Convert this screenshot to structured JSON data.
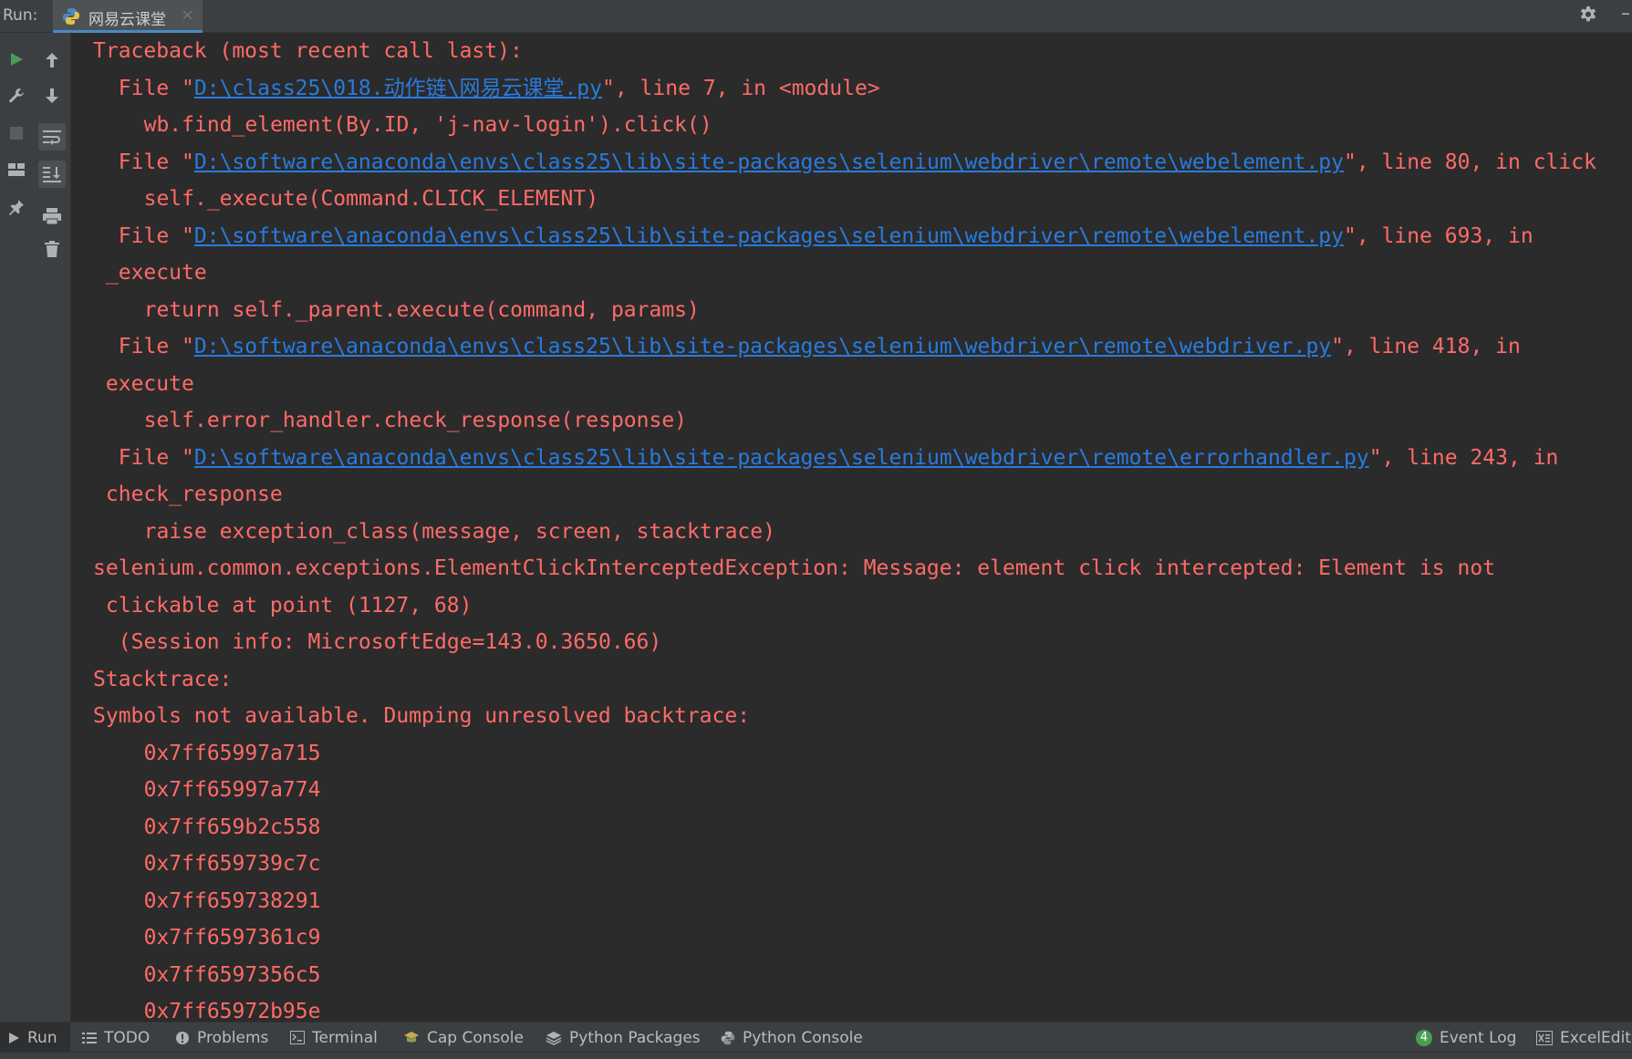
{
  "header": {
    "run_label": "Run:",
    "tab_title": "网易云课堂",
    "tab_close": "×",
    "hide_glyph": "–"
  },
  "console": {
    "lines": [
      {
        "indent": 0,
        "text": "Traceback (most recent call last):"
      },
      {
        "indent": 2,
        "pre": "File \"",
        "link": "D:\\class25\\018.动作链\\网易云课堂.py",
        "post": "\", line 7, in <module>"
      },
      {
        "indent": 4,
        "text": "wb.find_element(By.ID, 'j-nav-login').click()"
      },
      {
        "indent": 2,
        "pre": "File \"",
        "link": "D:\\software\\anaconda\\envs\\class25\\lib\\site-packages\\selenium\\webdriver\\remote\\webelement.py",
        "post": "\", line 80, in click"
      },
      {
        "indent": 4,
        "text": "self._execute(Command.CLICK_ELEMENT)"
      },
      {
        "indent": 2,
        "pre": "File \"",
        "link": "D:\\software\\anaconda\\envs\\class25\\lib\\site-packages\\selenium\\webdriver\\remote\\webelement.py",
        "post": "\", line 693, in"
      },
      {
        "indent": 1,
        "text": "_execute"
      },
      {
        "indent": 4,
        "text": "return self._parent.execute(command, params)"
      },
      {
        "indent": 2,
        "pre": "File \"",
        "link": "D:\\software\\anaconda\\envs\\class25\\lib\\site-packages\\selenium\\webdriver\\remote\\webdriver.py",
        "post": "\", line 418, in"
      },
      {
        "indent": 1,
        "text": "execute"
      },
      {
        "indent": 4,
        "text": "self.error_handler.check_response(response)"
      },
      {
        "indent": 2,
        "pre": "File \"",
        "link": "D:\\software\\anaconda\\envs\\class25\\lib\\site-packages\\selenium\\webdriver\\remote\\errorhandler.py",
        "post": "\", line 243, in"
      },
      {
        "indent": 1,
        "text": "check_response"
      },
      {
        "indent": 4,
        "text": "raise exception_class(message, screen, stacktrace)"
      },
      {
        "indent": 0,
        "text": "selenium.common.exceptions.ElementClickInterceptedException: Message: element click intercepted: Element is not"
      },
      {
        "indent": 1,
        "text": "clickable at point (1127, 68)"
      },
      {
        "indent": 2,
        "text": "(Session info: MicrosoftEdge=143.0.3650.66)"
      },
      {
        "indent": 0,
        "text": "Stacktrace:"
      },
      {
        "indent": 0,
        "text": "Symbols not available. Dumping unresolved backtrace:"
      },
      {
        "indent": 4,
        "text": "0x7ff65997a715"
      },
      {
        "indent": 4,
        "text": "0x7ff65997a774"
      },
      {
        "indent": 4,
        "text": "0x7ff659b2c558"
      },
      {
        "indent": 4,
        "text": "0x7ff659739c7c"
      },
      {
        "indent": 4,
        "text": "0x7ff659738291"
      },
      {
        "indent": 4,
        "text": "0x7ff6597361c9"
      },
      {
        "indent": 4,
        "text": "0x7ff6597356c5"
      },
      {
        "indent": 4,
        "text": "0x7ff65972b95e"
      }
    ]
  },
  "bottom_bar": {
    "run": "Run",
    "todo": "TODO",
    "problems": "Problems",
    "terminal": "Terminal",
    "cap_console": "Cap Console",
    "python_packages": "Python Packages",
    "python_console": "Python Console",
    "event_log": "Event Log",
    "event_log_count": "4",
    "excel_editor": "ExcelEdito"
  },
  "colors": {
    "error_text": "#ff6b68",
    "link": "#287bde",
    "run_green": "#499c54",
    "background": "#2b2b2b",
    "chrome": "#3c3f41"
  },
  "icons": {
    "toolbar_1": [
      "run-icon",
      "wrench-icon",
      "stop-icon",
      "layout-icon",
      "pin-icon"
    ],
    "toolbar_2": [
      "up-arrow-icon",
      "down-arrow-icon",
      "soft-wrap-icon",
      "scroll-to-end-icon",
      "print-icon",
      "trash-icon"
    ]
  }
}
